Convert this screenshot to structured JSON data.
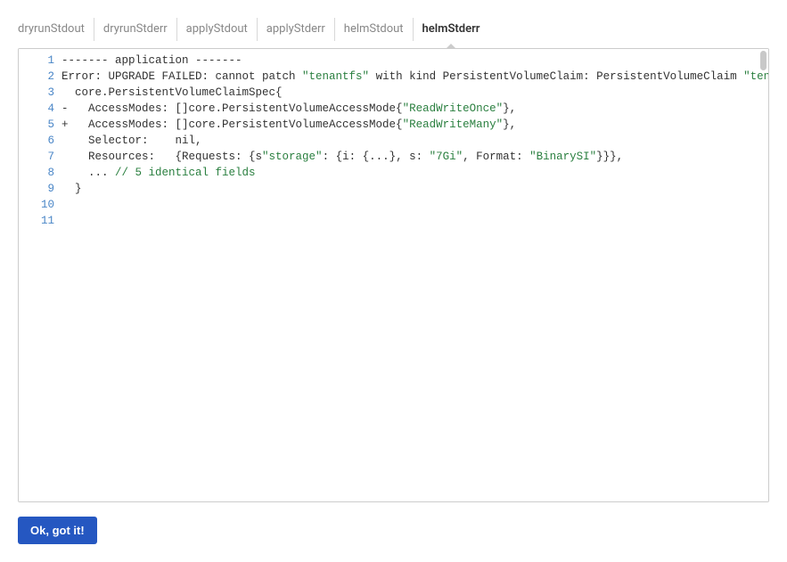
{
  "tabs": [
    {
      "label": "dryrunStdout",
      "active": false
    },
    {
      "label": "dryrunStderr",
      "active": false
    },
    {
      "label": "applyStdout",
      "active": false
    },
    {
      "label": "applyStderr",
      "active": false
    },
    {
      "label": "helmStdout",
      "active": false
    },
    {
      "label": "helmStderr",
      "active": true
    }
  ],
  "code": {
    "lines": [
      {
        "n": 1,
        "segs": [
          {
            "t": "------- application -------"
          }
        ]
      },
      {
        "n": 2,
        "segs": [
          {
            "t": "Error: UPGRADE FAILED: cannot patch "
          },
          {
            "t": "\"tenantfs\"",
            "c": "tok-str"
          },
          {
            "t": " with kind PersistentVolumeClaim: PersistentVolumeClaim "
          },
          {
            "t": "\"tenantfs\"",
            "c": "tok-str"
          }
        ]
      },
      {
        "n": 3,
        "segs": [
          {
            "t": "  core.PersistentVolumeClaimSpec{"
          }
        ]
      },
      {
        "n": 4,
        "segs": [
          {
            "t": "-   AccessModes: []core.PersistentVolumeAccessMode{"
          },
          {
            "t": "\"ReadWriteOnce\"",
            "c": "tok-str"
          },
          {
            "t": "},"
          }
        ]
      },
      {
        "n": 5,
        "segs": [
          {
            "t": "+   AccessModes: []core.PersistentVolumeAccessMode{"
          },
          {
            "t": "\"ReadWriteMany\"",
            "c": "tok-str"
          },
          {
            "t": "},"
          }
        ]
      },
      {
        "n": 6,
        "segs": [
          {
            "t": "    Selector:    nil,"
          }
        ]
      },
      {
        "n": 7,
        "segs": [
          {
            "t": "    Resources:   {Requests: {s"
          },
          {
            "t": "\"storage\"",
            "c": "tok-str"
          },
          {
            "t": ": {i: {...}, s: "
          },
          {
            "t": "\"7Gi\"",
            "c": "tok-str"
          },
          {
            "t": ", Format: "
          },
          {
            "t": "\"BinarySI\"",
            "c": "tok-str"
          },
          {
            "t": "}}},"
          }
        ]
      },
      {
        "n": 8,
        "segs": [
          {
            "t": "    ... "
          },
          {
            "t": "// 5 identical fields",
            "c": "tok-comment"
          }
        ]
      },
      {
        "n": 9,
        "segs": [
          {
            "t": "  }"
          }
        ]
      },
      {
        "n": 10,
        "segs": [
          {
            "t": ""
          }
        ]
      },
      {
        "n": 11,
        "segs": [
          {
            "t": ""
          }
        ]
      }
    ]
  },
  "button": {
    "ok_label": "Ok, got it!"
  }
}
